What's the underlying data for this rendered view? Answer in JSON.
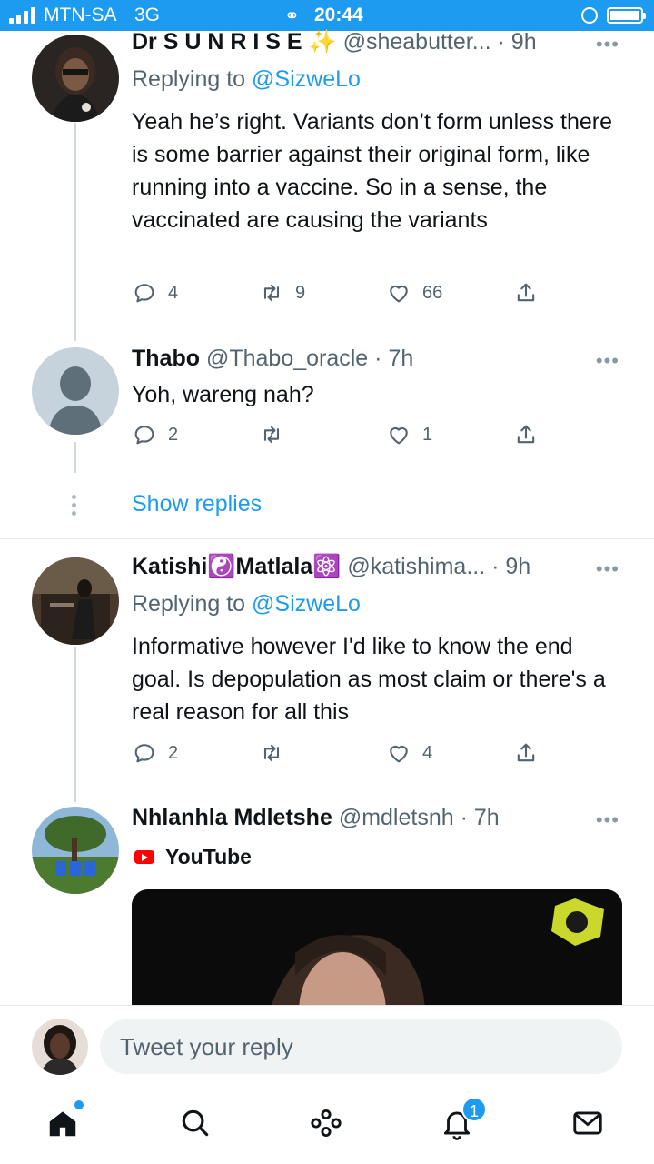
{
  "status_bar": {
    "carrier": "MTN-SA",
    "network": "3G",
    "time": "20:44"
  },
  "tweets": [
    {
      "display_name": "Dr S U N R I S E",
      "emoji": "✨",
      "handle": "@sheabutter...",
      "time": "· 9h",
      "replying_label": "Replying to",
      "replying_to": "@SizweLo",
      "text": "Yeah he’s right. Variants don’t form unless there is some barrier against their original form, like running into a vaccine. So in a sense, the vaccinated are causing the variants",
      "replies": "4",
      "retweets": "9",
      "likes": "66"
    },
    {
      "display_name": "Thabo",
      "handle": "@Thabo_oracle",
      "time": "· 7h",
      "text": "Yoh, wareng nah?",
      "replies": "2",
      "retweets": "",
      "likes": "1"
    },
    {
      "display_name_a": "Katishi",
      "emoji_a": "☯️",
      "display_name_b": "Matlala",
      "emoji_b": "⚛️",
      "handle": "@katishima...",
      "time": "· 9h",
      "replying_label": "Replying to",
      "replying_to": "@SizweLo",
      "text": "Informative however I'd like to know the end goal. Is depopulation as most claim or there's a real reason for all this",
      "replies": "2",
      "retweets": "",
      "likes": "4"
    },
    {
      "display_name": "Nhlanhla Mdletshe",
      "handle": "@mdletsnh",
      "time": "· 7h",
      "card_source": "YouTube"
    }
  ],
  "show_replies_label": "Show replies",
  "more_label": "•••",
  "reply_bar": {
    "placeholder": "Tweet your reply"
  },
  "bottom_nav": {
    "notifications_badge": "1"
  },
  "colors": {
    "accent": "#1d9bf0",
    "text": "#0f1419",
    "secondary": "#536471"
  }
}
